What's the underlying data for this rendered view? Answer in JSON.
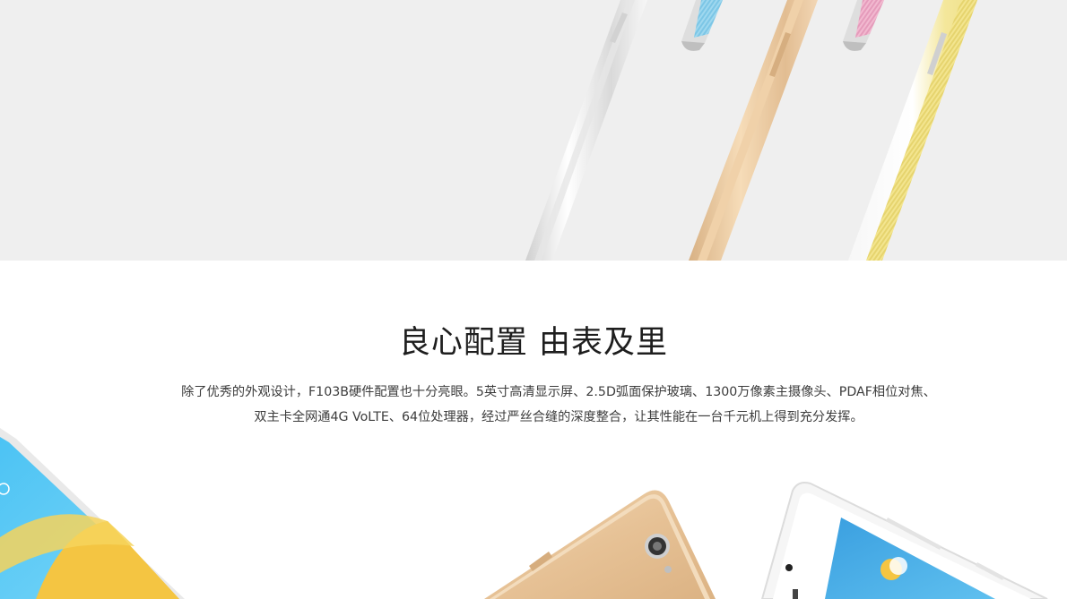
{
  "section": {
    "title": "良心配置 由表及里",
    "description_line1": "除了优秀的外观设计，F103B硬件配置也十分亮眼。5英寸高清显示屏、2.5D弧面保护玻璃、1300万像素主摄像头、PDAF相位对焦、",
    "description_line2": "双主卡全网通4G VoLTE、64位处理器，经过严丝合缝的深度整合，让其性能在一台千元机上得到充分发挥。"
  },
  "images": {
    "top_banner": {
      "subject": "phone-side-views",
      "colors": [
        "#f2f2f2",
        "#e9c79f",
        "#f5e9a0"
      ],
      "cable_colors": [
        "#a9dcf0",
        "#f3bcd2"
      ]
    },
    "bottom_banner": {
      "subject": "phone-front-and-back-views",
      "colors": [
        "#5ac8f5",
        "#e4bf94",
        "#f4f4f4"
      ]
    }
  }
}
